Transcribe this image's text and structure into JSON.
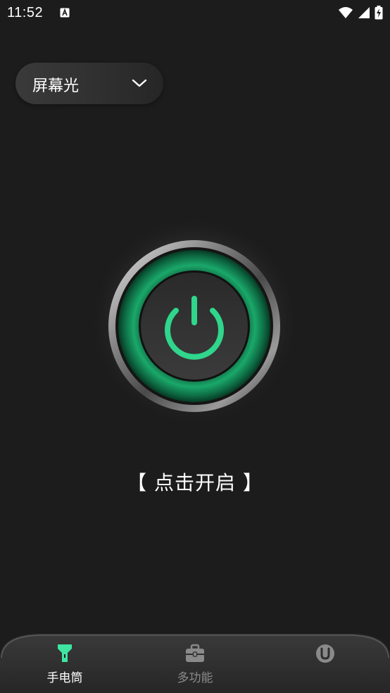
{
  "status_bar": {
    "time": "11:52"
  },
  "mode_selector": {
    "label": "屏幕光"
  },
  "power": {
    "caption": "【 点击开启 】",
    "accent": "#2fd68c"
  },
  "tabs": [
    {
      "label": "手电筒",
      "active": true
    },
    {
      "label": "多功能",
      "active": false
    },
    {
      "label": "",
      "active": false
    }
  ],
  "colors": {
    "background": "#1c1c1c",
    "active_tab": "#3ee6a1",
    "inactive_tab": "#8a8a8a"
  }
}
